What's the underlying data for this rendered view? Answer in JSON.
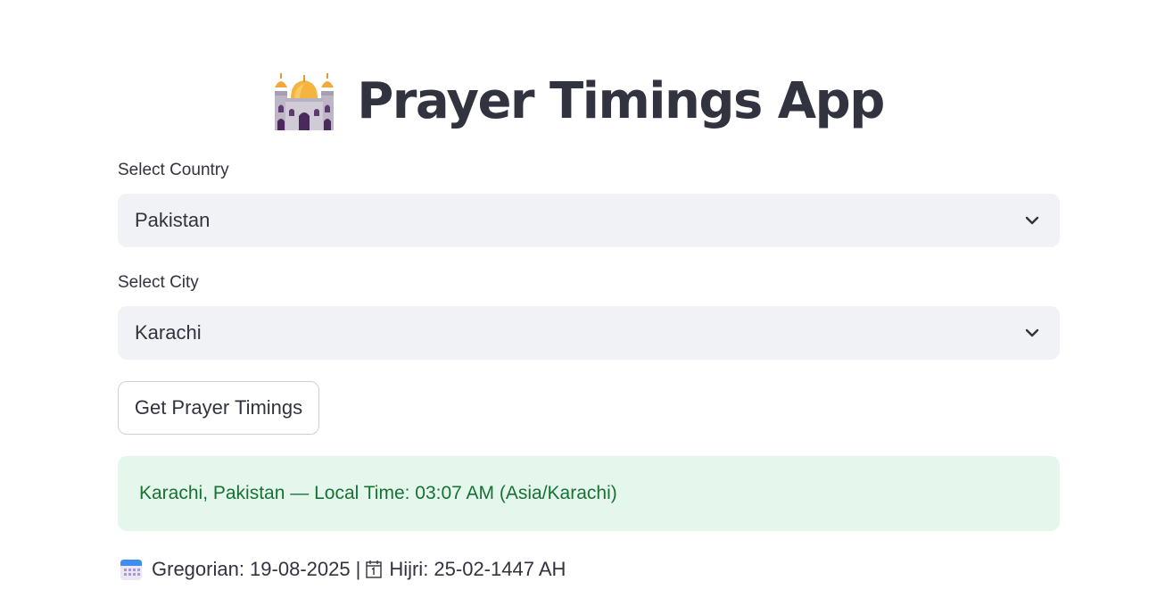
{
  "header": {
    "icon": "mosque-icon",
    "title": "Prayer Timings App"
  },
  "country": {
    "label": "Select Country",
    "value": "Pakistan"
  },
  "city": {
    "label": "Select City",
    "value": "Karachi"
  },
  "action": {
    "label": "Get Prayer Timings"
  },
  "result": {
    "message": "Karachi, Pakistan — Local Time: 03:07 AM (Asia/Karachi)"
  },
  "dates": {
    "gregorian_icon": "calendar-icon",
    "gregorian": "Gregorian: 19-08-2025",
    "separator": "|",
    "hijri_icon": "date-icon",
    "hijri": "Hijri: 25-02-1447 AH"
  },
  "colors": {
    "text": "#31333f",
    "select_bg": "#f0f2f6",
    "success_bg": "#e5f7ec",
    "success_text": "#177233"
  }
}
